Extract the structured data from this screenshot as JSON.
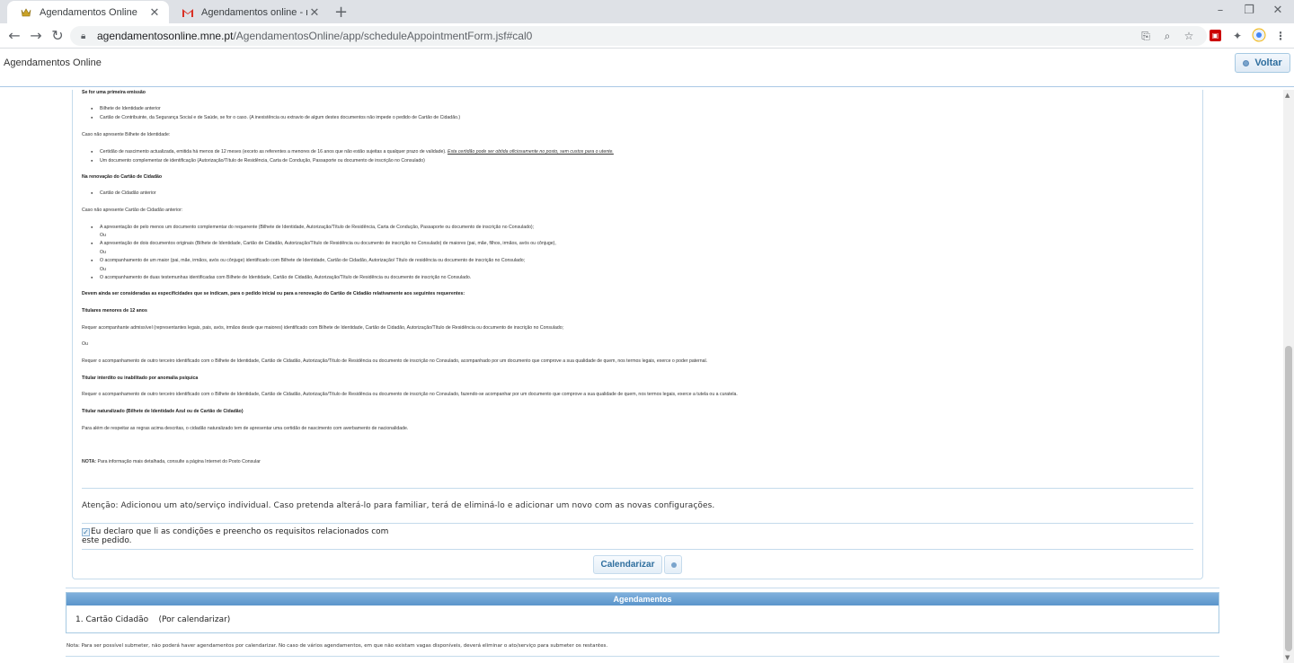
{
  "browser": {
    "tabs": [
      {
        "title": "Agendamentos Online",
        "active": true
      },
      {
        "title": "Agendamentos online - registo c",
        "active": false
      }
    ],
    "url_host": "agendamentosonline.mne.pt",
    "url_path": "/AgendamentosOnline/app/scheduleAppointmentForm.jsf#cal0"
  },
  "header": {
    "title": "Agendamentos Online",
    "back_label": "Voltar"
  },
  "doc": {
    "h_first": "Se for uma primeira emissão",
    "first_items": [
      "Bilhete de Identidade anterior",
      "Cartão de Contribuinte, da Segurança Social e de Saúde, se for o caso. (A inexistência ou extravio de algum destes documentos não impede o pedido de Cartão de Cidadão.)"
    ],
    "no_bi": "Caso não apresente Bilhete de Identidade:",
    "no_bi_item1_a": "Certidão de nascimento actualizada, emitida há menos de 12 meses (exceto as referentes a menores de 16 anos que não estão sujeitas a qualquer prazo de validade).",
    "no_bi_item1_b": "Esta certidão pode ser obtida oficiosamente no posto, sem custos para o utente.",
    "no_bi_item2": "Um documento complementar de identificação (Autorização/Título de Residência, Carta de Condução, Passaporte ou documento de inscrição no Consulado)",
    "h_renov": "Na renovação do Cartão de Cidadão",
    "renov_item": "Cartão de Cidadão anterior",
    "no_cc": "Caso não apresente Cartão de Cidadão anterior:",
    "no_cc_items": [
      "A apresentação de pelo menos um documento complementar do requerente (Bilhete de Identidade, Autorização/Título de Residência, Carta de Condução, Passaporte ou documento de inscrição no Consulado);",
      "A apresentação de dois documentos originais (Bilhete de Identidade, Cartão de Cidadão, Autorização/Título de Residência ou documento de inscrição no Consulado) de maiores (pai, mãe, filhos, irmãos, avós ou cônjuge),",
      "O acompanhamento de um maior (pai, mãe, irmãos, avós ou cônjuge) identificado com Bilhete de Identidade, Cartão de Cidadão, Autorização/ Título de residência ou documento de inscrição no Consulado;",
      "O acompanhamento de duas testemunhas identificadas com Bilhete de Identidade, Cartão de Cidadão, Autorização/Título de Residência ou documento de inscrição no Consulado."
    ],
    "ou": "Ou",
    "h_specific": "Devem ainda ser consideradas as especificidades que se indicam, para o pedido inicial ou para a renovação do Cartão de Cidadão relativamente aos seguintes requerentes:",
    "h_minors": "Titulares menores de 12 anos",
    "minors_p1": "Requer acompanhante admissível (representantes legais, pais, avós, irmãos desde que maiores) identificado com Bilhete de Identidade, Cartão de Cidadão, Autorização/Título de Residência ou documento de inscrição no Consulado;",
    "minors_p2": "Requer o acompanhamento de outro terceiro identificado com o Bilhete de Identidade, Cartão de Cidadão, Autorização/Título de Residência ou documento de inscrição no Consulado, acompanhado por um documento que comprove a sua qualidade de quem, nos termos legais, exerce o poder paternal.",
    "h_interdito": "Titular interdito ou inabilitado por anomalia psíquica",
    "interdito_p": "Requer o acompanhamento de outro terceiro identificado com o Bilhete de Identidade, Cartão de Cidadão, Autorização/Título de Residência ou documento de inscrição no Consulado, fazendo-se acompanhar por um documento que comprove a sua qualidade de quem, nos termos legais, exerce a tutela ou a curatela.",
    "h_natur": "Titular naturalizado (Bilhete de Identidade Azul ou de Cartão de Cidadão)",
    "natur_p": "Para além de respeitar as regras acima descritas, o cidadão naturalizado tem de apresentar uma certidão de nascimento com averbamento de nacionalidade.",
    "nota_label": "NOTA:",
    "nota_text": "Para informação mais detalhada, consulte a página Internet do Posto Consular"
  },
  "form": {
    "notice": "Atenção: Adicionou um ato/serviço individual. Caso pretenda alterá-lo para familiar, terá de eliminá-lo e adicionar um novo com as novas configurações.",
    "declare_label": "Eu declaro que li as condições e preencho os requisitos relacionados com este pedido.",
    "declare_checked": true,
    "schedule_label": "Calendarizar"
  },
  "agendamentos": {
    "header": "Agendamentos",
    "items": [
      {
        "text": "1. Cartão Cidadão    (Por calendarizar)"
      }
    ],
    "footnote": "Nota: Para ser possível submeter, não poderá haver agendamentos por calendarizar. No caso de vários agendamentos, em que não existam vagas disponíveis, deverá eliminar o ato/serviço para submeter os restantes."
  }
}
